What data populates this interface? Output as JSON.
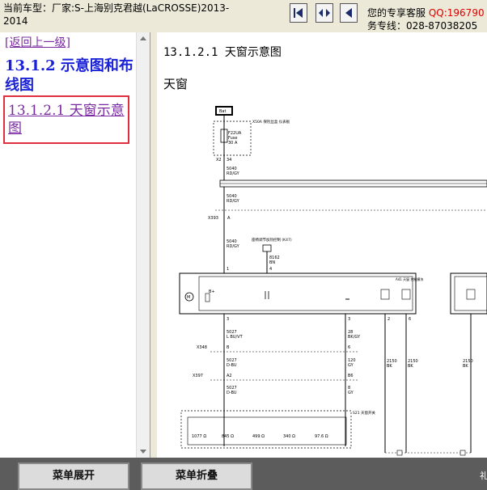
{
  "header": {
    "car_info": "当前车型：厂家:S-上海别克君越(LaCROSSE)2013-2014",
    "service_label": "您的专享客服",
    "service_qq": "QQ:196790",
    "service_phone": "务专线：028-87038205",
    "nav_icons": [
      "first-page-icon",
      "fit-page-icon",
      "prev-page-icon"
    ]
  },
  "sidebar": {
    "back_label": "[返回上一级]",
    "section_title": "13.1.2 示意图和布线图",
    "selected_item": "13.1.2.1 天窗示意图"
  },
  "content": {
    "title": "13.1.2.1 天窗示意图",
    "subtitle": "天窗"
  },
  "diagram": {
    "bat_label": "Bat",
    "fuse_block_label": "X50A 保险丝盒 仪表板",
    "fuse_label": "F22UA",
    "fuse_label2": "Fuse",
    "fuse_amps": "30 A",
    "conn_x2": "X2",
    "pin_34": "34",
    "wire_5040a": "5040",
    "color_rdgy_a": "RD/GY",
    "wire_5040b": "5040",
    "color_rdgy_b": "RD/GY",
    "conn_x393": "X393",
    "conn_a": "A",
    "wire_5040c": "5040",
    "color_rdgy_c": "RD/GY",
    "ground_label": "座椅调节加热控制 (K47)",
    "wire_8162": "8162",
    "color_bn": "BN",
    "pin_1": "1",
    "pin_4": "4",
    "module_label": "A41 天窗 控制模块",
    "b_plus": "B+",
    "pin_3a": "3",
    "pin_2": "2",
    "pin_6": "6",
    "pin_3b": "3",
    "wire_5027a": "5027",
    "color_lbuvt": "L BU/VT",
    "wire_28": "28",
    "color_bkgy": "BK/GY",
    "conn_x348": "X348",
    "pin_b": "B",
    "pin_6b": "6",
    "wire_5027b": "5027",
    "color_dbu_a": "D-BU",
    "wire_120": "120",
    "color_gy_a": "GY",
    "wire_2150a": "2150",
    "color_bk_a": "BK",
    "wire_2150b": "2150",
    "color_bk_b": "BK",
    "wire_2150c": "2150",
    "color_bk_c": "BK",
    "conn_x397": "X397",
    "pin_a2": "A2",
    "pin_b6": "B6",
    "wire_5027c": "5027",
    "color_dbu_b": "D-BU",
    "wire_8b": "8",
    "color_gy_b": "GY",
    "switch_label": "S21 天窗开关",
    "resistors": [
      "1077 Ω",
      "845 Ω",
      "499 Ω",
      "340 Ω",
      "97.6 Ω"
    ]
  },
  "footer": {
    "expand_label": "菜单展开",
    "collapse_label": "菜单折叠",
    "corner_text": "礼"
  }
}
